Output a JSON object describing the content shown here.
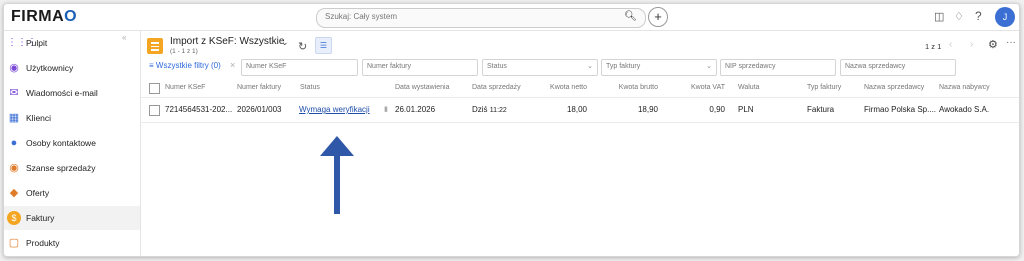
{
  "app": {
    "logo_prefix": "FIRMA",
    "logo_suffix": "O"
  },
  "topbar": {
    "search_placeholder": "Szukaj: Cały system",
    "user_initial": "J"
  },
  "sidebar": {
    "items": [
      {
        "label": "Pulpit",
        "icon": "grid-icon",
        "color": "#7b4bd6"
      },
      {
        "label": "Użytkownicy",
        "icon": "user-circle-icon",
        "color": "#7b4bd6"
      },
      {
        "label": "Wiadomości e-mail",
        "icon": "envelope-icon",
        "color": "#7b4bd6"
      },
      {
        "label": "Klienci",
        "icon": "building-icon",
        "color": "#3b6fd4"
      },
      {
        "label": "Osoby kontaktowe",
        "icon": "people-icon",
        "color": "#3b6fd4"
      },
      {
        "label": "Szanse sprzedaży",
        "icon": "money-bag-icon",
        "color": "#e07b2a"
      },
      {
        "label": "Oferty",
        "icon": "tag-icon",
        "color": "#e07b2a"
      },
      {
        "label": "Faktury",
        "icon": "dollar-icon",
        "color": "#f4a623",
        "active": true
      },
      {
        "label": "Produkty",
        "icon": "box-icon",
        "color": "#e07b2a"
      }
    ]
  },
  "header": {
    "title": "Import z KSeF: Wszystkie",
    "subtitle": "(1 - 1 z 1)",
    "pagination": "1 z 1"
  },
  "filters": {
    "all_filters": "Wszystkie filtry (0)",
    "numer_ksef": "Numer KSeF",
    "numer_faktury": "Numer faktury",
    "status": "Status",
    "typ_faktury": "Typ faktury",
    "nip_sprzedawcy": "NIP sprzedawcy",
    "nazwa_sprzedawcy": "Nazwa sprzedawcy"
  },
  "table": {
    "columns": {
      "numer_ksef": "Numer KSeF",
      "numer_faktury": "Numer faktury",
      "status": "Status",
      "data_wystawienia": "Data wystawienia",
      "data_sprzedazy": "Data sprzedaży",
      "kwota_netto": "Kwota netto",
      "kwota_brutto": "Kwota brutto",
      "kwota_vat": "Kwota VAT",
      "waluta": "Waluta",
      "typ_faktury": "Typ faktury",
      "nazwa_sprzedawcy": "Nazwa sprzedawcy",
      "nazwa_nabywcy": "Nazwa nabywcy"
    },
    "row": {
      "numer_ksef": "7214564531-202...",
      "numer_faktury": "2026/01/003",
      "status": "Wymaga weryfikacji",
      "data_wystawienia": "26.01.2026",
      "data_sprzedazy_day": "Dziś",
      "data_sprzedazy_time": "11:22",
      "kwota_netto": "18,00",
      "kwota_brutto": "18,90",
      "kwota_vat": "0,90",
      "waluta": "PLN",
      "typ_faktury": "Faktura",
      "nazwa_sprzedawcy": "Firmao Polska Sp....",
      "nazwa_nabywcy": "Awokado S.A."
    }
  },
  "annotation": {
    "arrow_color": "#2f58a8"
  }
}
